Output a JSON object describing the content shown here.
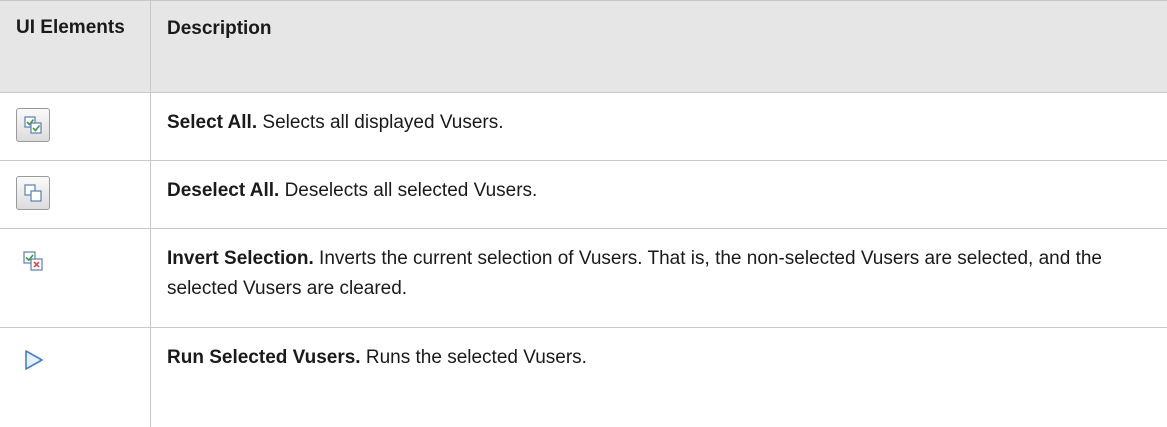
{
  "header": {
    "col1": "UI Elements",
    "col2": "Description"
  },
  "rows": [
    {
      "icon": "select-all-icon",
      "title": "Select All.",
      "text": " Selects all displayed Vusers."
    },
    {
      "icon": "deselect-all-icon",
      "title": "Deselect All.",
      "text": " Deselects all selected Vusers."
    },
    {
      "icon": "invert-selection-icon",
      "title": "Invert Selection.",
      "text": " Inverts the current selection of Vusers. That is, the non-selected Vusers are selected, and the selected Vusers are cleared."
    },
    {
      "icon": "run-selected-icon",
      "title": "Run Selected Vusers.",
      "text": " Runs the selected Vusers."
    }
  ],
  "colors": {
    "header_bg": "#e6e6e6",
    "border": "#c8c8c8",
    "icon_blue": "#4a7fc1",
    "icon_green": "#3a9a3a",
    "icon_red": "#d04040"
  }
}
